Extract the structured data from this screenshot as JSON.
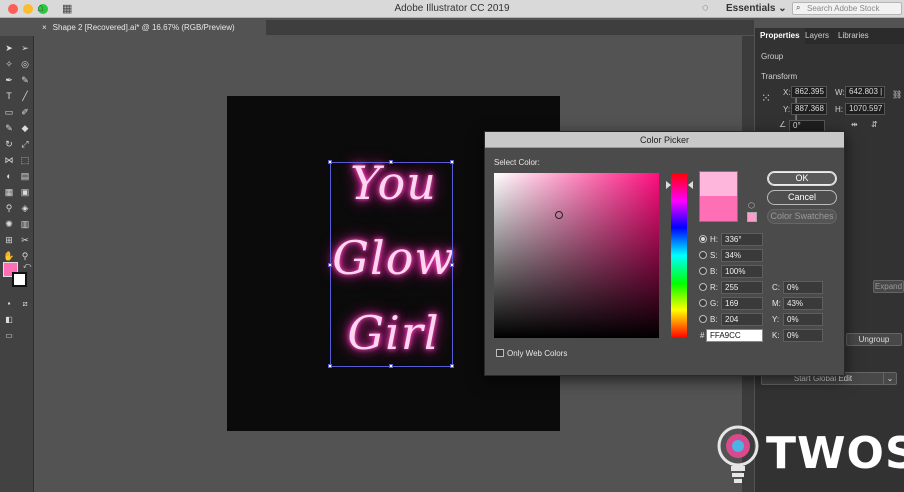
{
  "app": {
    "title": "Adobe Illustrator CC 2019",
    "workspace": "Essentials",
    "search_placeholder": "Search Adobe Stock"
  },
  "document": {
    "tab_label": "Shape 2 [Recovered].ai* @ 16.67% (RGB/Preview)"
  },
  "artwork": {
    "lines": [
      "You",
      "Glow",
      "Girl"
    ],
    "glow_color": "#ff2db3"
  },
  "properties": {
    "tabs": [
      "Properties",
      "Layers",
      "Libraries"
    ],
    "group_label": "Group",
    "transform_label": "Transform",
    "x_label": "X:",
    "x_value": "862.395 |",
    "y_label": "Y:",
    "y_value": "887.368 |",
    "w_label": "W:",
    "w_value": "642.803 |",
    "h_label": "H:",
    "h_value": "1070.597",
    "angle_value": "0°",
    "expand_label": "Expand",
    "ungroup_label": "Ungroup",
    "global_edit_label": "Start Global Edit"
  },
  "color_picker": {
    "title": "Color Picker",
    "select_color_label": "Select Color:",
    "ok_label": "OK",
    "cancel_label": "Cancel",
    "swatches_label": "Color Swatches",
    "only_web_colors_label": "Only Web Colors",
    "new_color": "#ffb6dc",
    "current_color": "#ff6fb5",
    "fields": {
      "H": "336°",
      "S": "34%",
      "B_hsb": "100%",
      "R": "255",
      "G": "169",
      "B_rgb": "204",
      "C": "0%",
      "M": "43%",
      "Y": "0%",
      "K": "0%",
      "hex": "FFA9CC"
    },
    "labels": {
      "H": "H:",
      "S": "S:",
      "B": "B:",
      "R": "R:",
      "G": "G:",
      "Bb": "B:",
      "C": "C:",
      "M": "M:",
      "Y": "Y:",
      "K": "K:",
      "hash": "#"
    }
  },
  "watermark": {
    "text": "TWOS"
  }
}
